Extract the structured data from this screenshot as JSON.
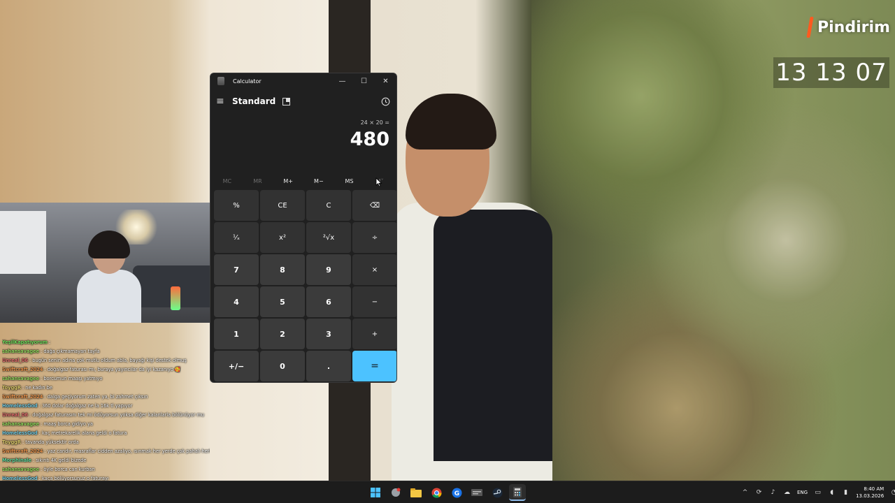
{
  "brand": {
    "name": "Pindirim",
    "clock": "13 13 07",
    "accent": "#ff5a1f"
  },
  "calculator": {
    "title": "Calculator",
    "mode": "Standard",
    "expression": "24 × 20 =",
    "result": "480",
    "window_controls": {
      "minimize": "—",
      "maximize": "☐",
      "close": "✕"
    },
    "memory": [
      "MC",
      "MR",
      "M+",
      "M−",
      "MS",
      "M˅"
    ],
    "memory_disabled": [
      true,
      true,
      false,
      false,
      false,
      true
    ],
    "keys": [
      {
        "label": "%",
        "kind": "op"
      },
      {
        "label": "CE",
        "kind": "op"
      },
      {
        "label": "C",
        "kind": "op"
      },
      {
        "label": "⌫",
        "kind": "op"
      },
      {
        "label": "¹⁄ₓ",
        "kind": "op"
      },
      {
        "label": "x²",
        "kind": "op"
      },
      {
        "label": "²√x",
        "kind": "op"
      },
      {
        "label": "÷",
        "kind": "op"
      },
      {
        "label": "7",
        "kind": "num"
      },
      {
        "label": "8",
        "kind": "num"
      },
      {
        "label": "9",
        "kind": "num"
      },
      {
        "label": "×",
        "kind": "op"
      },
      {
        "label": "4",
        "kind": "num"
      },
      {
        "label": "5",
        "kind": "num"
      },
      {
        "label": "6",
        "kind": "num"
      },
      {
        "label": "−",
        "kind": "op"
      },
      {
        "label": "1",
        "kind": "num"
      },
      {
        "label": "2",
        "kind": "num"
      },
      {
        "label": "3",
        "kind": "num"
      },
      {
        "label": "+",
        "kind": "op"
      },
      {
        "label": "+/−",
        "kind": "num"
      },
      {
        "label": "0",
        "kind": "num"
      },
      {
        "label": ".",
        "kind": "num"
      },
      {
        "label": "=",
        "kind": "eq"
      }
    ],
    "accent": "#4cc2ff"
  },
  "chat": [
    {
      "user": "YeşilKapatıyorum",
      "msg": ":",
      "color": "#6fdc5c"
    },
    {
      "user": "sahansavagee",
      "msg": ": dağa çıkmamayarı tayfa",
      "color": "#8fd35c"
    },
    {
      "user": "Unreal_06",
      "msg": ": bugün senin adına çok mutlu oldum abla, bayağı kişi destek olmuş",
      "color": "#e06c6c"
    },
    {
      "user": "Swiftcraft_2024",
      "msg": ": doğalgaz faturası mı, buraya yayıncılar da iyi kazanıyo 🥰",
      "color": "#e38f4a"
    },
    {
      "user": "sahansavagee",
      "msg": ": borcumun maaşı yatmıyo",
      "color": "#8fd35c"
    },
    {
      "user": "ToyggR",
      "msg": ": ne kadın be",
      "color": "#d9c86a"
    },
    {
      "user": "Swiftcraft_2024",
      "msg": ": dalga geçiyorum zaten ya, bi zahmet çıksın",
      "color": "#e38f4a"
    },
    {
      "user": "HomelessGod",
      "msg": ": 360 dolar doğalgaz ne la 16k tl yapıyor",
      "color": "#6fc5dd"
    },
    {
      "user": "Unreal_06",
      "msg": ": doğalgaz faturasını tek mi ödüyorsun yoksa diğer kalanlarla bölünüyor mu",
      "color": "#e06c6c"
    },
    {
      "user": "sahansavagee",
      "msg": ": maaş borca gidiyo ya",
      "color": "#8fd35c"
    },
    {
      "user": "HomelessGod",
      "msg": ": kaç metrekarelik alana geldi o fatura",
      "color": "#6fc5dd"
    },
    {
      "user": "ToyggR",
      "msg": ": tavanda yüksektir orda",
      "color": "#d9c86a"
    },
    {
      "user": "Swiftcraft_2024",
      "msg": ": yaz candır, masraflar cidden azalıyo, ısınmak her yerde çok pahalı herhalde",
      "color": "#e38f4a"
    },
    {
      "user": "Morphinale",
      "msg": ": sıkıntı 4K geldi bizede",
      "color": "#5fd39a"
    },
    {
      "user": "sahansavagee",
      "msg": ": öyle borca can kurban",
      "color": "#8fd35c"
    },
    {
      "user": "HomelessGod",
      "msg": ": kaça bölüyorsunuz o faturayı",
      "color": "#6fc5dd"
    },
    {
      "user": "Unreal_06",
      "msg": ": kızlarla aran nasıl abla anlaşabiliyor musun.",
      "color": "#e06c6c"
    },
    {
      "user": "sahansavagee",
      "msg": ": bankalardan vur emrimiz var .d",
      "color": "#8fd35c"
    }
  ],
  "taskbar": {
    "apps": [
      "start",
      "steam-overlay",
      "file-explorer",
      "chrome",
      "google",
      "obs",
      "steam",
      "calculator"
    ],
    "lang": "ENG",
    "time": "8:40 AM",
    "date": "13.03.2026"
  }
}
